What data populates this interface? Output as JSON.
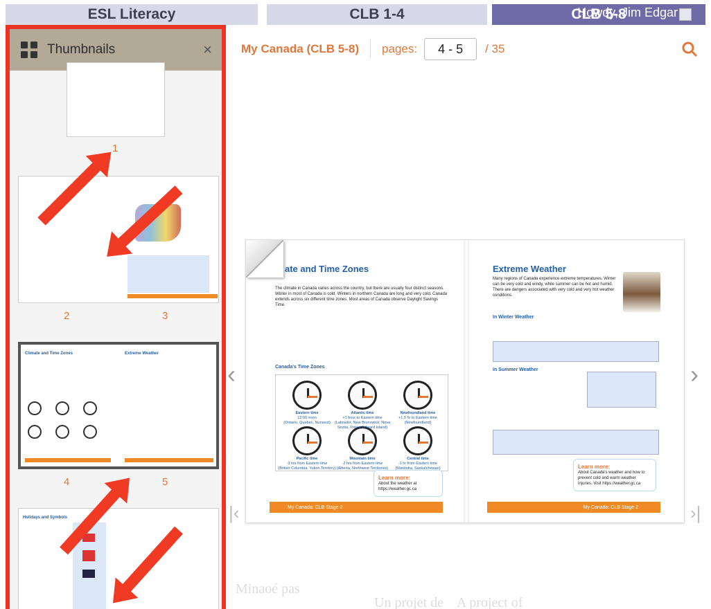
{
  "tabs": [
    {
      "label": "ESL Literacy"
    },
    {
      "label": "CLB 1-4"
    },
    {
      "label": "CLB 5-8"
    }
  ],
  "user": {
    "greeting": "Howdy, Jim Edgar"
  },
  "sidebar": {
    "title": "Thumbnails",
    "close": "×",
    "page_labels": [
      "1",
      "2",
      "3",
      "4",
      "5"
    ]
  },
  "viewer": {
    "book_title": "My Canada (CLB 5-8)",
    "pages_label": "pages:",
    "pages_value": "4 - 5",
    "total": "/ 35",
    "left_page": {
      "title": "ate and Time Zones",
      "section": "Canada's Time Zones",
      "learn_more_title": "Learn more:",
      "learn_more_body": "About the weather at https://weather.gc.ca",
      "footer": "My Canada: CLB Stage 2",
      "page_no": "4",
      "time_zones": [
        {
          "name": "Eastern time",
          "sub": "12:00 noon",
          "note": "(Ontario, Quebec, Nunavut)"
        },
        {
          "name": "Atlantic time",
          "sub": "+1 hour to Eastern time",
          "note": "(Labrador, New Brunswick, Nova Scotia, Prince Edward Island)"
        },
        {
          "name": "Newfoundland time",
          "sub": "+1.5 hr to Eastern time",
          "note": "(Newfoundland)"
        },
        {
          "name": "Pacific time",
          "sub": "-3 hrs from Eastern time",
          "note": "(British Columbia, Yukon Territory)"
        },
        {
          "name": "Mountain time",
          "sub": "-2 hrs from Eastern time",
          "note": "(Alberta, Northwest Territories)"
        },
        {
          "name": "Central time",
          "sub": "-1 hr from Eastern time",
          "note": "(Manitoba, Saskatchewan)"
        }
      ]
    },
    "right_page": {
      "title": "Extreme Weather",
      "winter_heading": "In Winter Weather",
      "summer_heading": "In Summer Weather",
      "learn_more_title": "Learn more:",
      "learn_more_body": "About Canada's weather and how to prevent cold and warm weather injuries. Visit https://weather.gc.ca",
      "footer": "My Canada: CLB Stage 2",
      "page_no": "5"
    }
  }
}
